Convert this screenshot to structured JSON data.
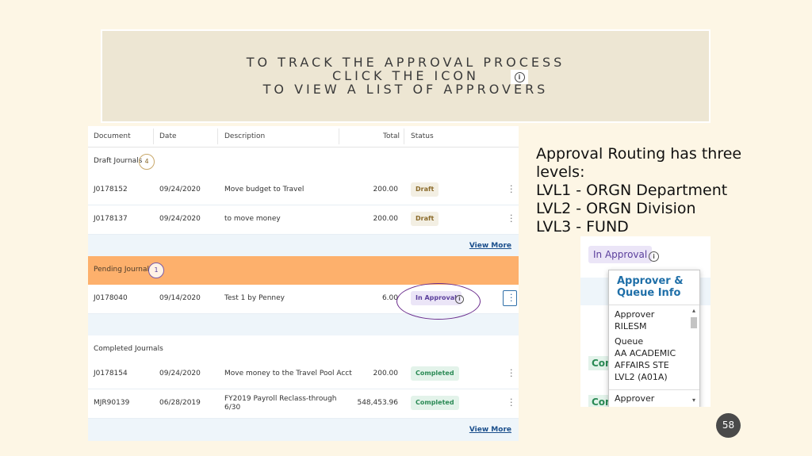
{
  "banner": {
    "line1": "TO TRACK THE APPROVAL PROCESS",
    "line2": "CLICK THE ICON",
    "line3": "TO VIEW A LIST OF APPROVERS",
    "icon": "info-icon"
  },
  "table": {
    "headers": [
      "Document",
      "Date",
      "Description",
      "Total",
      "Status"
    ],
    "draft_group": {
      "label": "Draft Journals",
      "count": "4"
    },
    "draft_rows": [
      {
        "document": "J0178152",
        "date": "09/24/2020",
        "description": "Move budget to Travel",
        "total": "200.00",
        "status": "Draft"
      },
      {
        "document": "J0178137",
        "date": "09/24/2020",
        "description": "to move money",
        "total": "200.00",
        "status": "Draft"
      }
    ],
    "view_more": "View More",
    "pending_group": {
      "label": "Pending Journals",
      "count": "1"
    },
    "pending_rows": [
      {
        "document": "J0178040",
        "date": "09/14/2020",
        "description": "Test 1 by Penney",
        "total": "6.00",
        "status": "In Approval"
      }
    ],
    "completed_group": {
      "label": "Completed Journals"
    },
    "completed_rows": [
      {
        "document": "J0178154",
        "date": "09/24/2020",
        "description": "Move money to the Travel Pool Acct",
        "total": "200.00",
        "status": "Completed"
      },
      {
        "document": "MJR90139",
        "date": "06/28/2019",
        "description_line1": "FY2019 Payroll Reclass-through",
        "description_line2": "6/30",
        "total": "548,453.96",
        "status": "Completed"
      }
    ]
  },
  "routing": {
    "intro": "Approval Routing has three levels:",
    "levels": [
      "LVL1 - ORGN Department",
      "LVL2 - ORGN Division",
      "LVL3 - FUND"
    ]
  },
  "popup": {
    "badge": "In Approval",
    "title": "Approver & Queue Info",
    "approver_label": "Approver",
    "approver_value": "RILESM",
    "queue_label": "Queue",
    "queue_value_1": "AA ACADEMIC",
    "queue_value_2": "AFFAIRS STE",
    "queue_value_3": "LVL2 (A01A)",
    "next_label": "Approver",
    "behind_left": "Com"
  },
  "page_number": "58",
  "colors": {
    "background": "#fdf6e5",
    "pending_band": "#fdb06c",
    "accent_purple": "#6a2b8c",
    "link": "#1b4f8c"
  }
}
